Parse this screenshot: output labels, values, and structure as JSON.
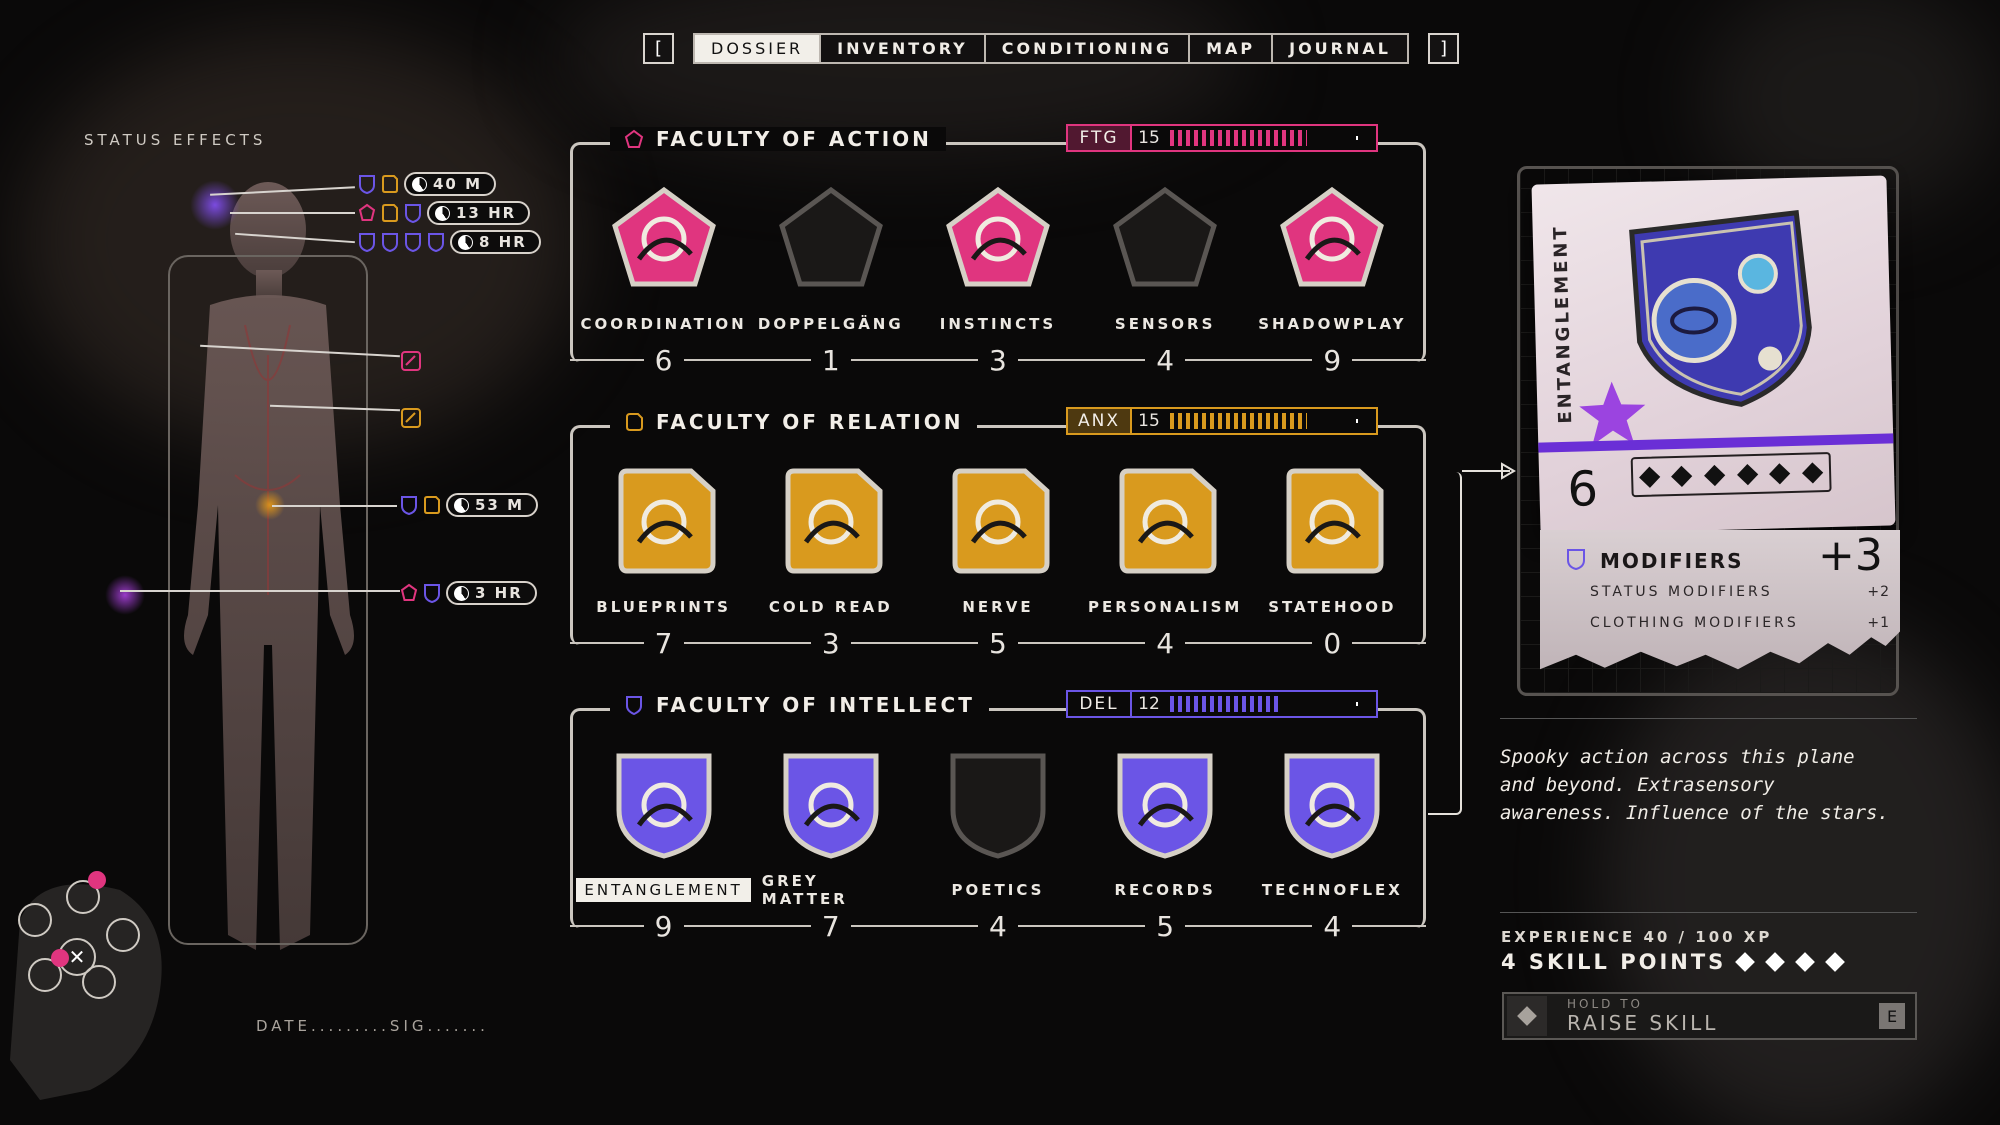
{
  "nav": {
    "left_bracket": "[",
    "right_bracket": "]",
    "tabs": [
      "DOSSIER",
      "INVENTORY",
      "CONDITIONING",
      "MAP",
      "JOURNAL"
    ],
    "active_tab": "DOSSIER"
  },
  "status": {
    "title": "STATUS EFFECTS",
    "effects": [
      {
        "duration": "40 M"
      },
      {
        "duration": "13 HR"
      },
      {
        "duration": "8 HR"
      },
      {
        "duration": "53 M"
      },
      {
        "duration": "3 HR"
      }
    ],
    "date_sig": "DATE.........SIG......."
  },
  "faculties": [
    {
      "title": "FACULTY OF ACTION",
      "meter_code": "FTG",
      "meter_value": "15",
      "meter_fraction": 0.85,
      "color": "#e0357f",
      "skills": [
        {
          "name": "COORDINATION",
          "value": "6"
        },
        {
          "name": "DOPPELGÄNG",
          "value": "1"
        },
        {
          "name": "INSTINCTS",
          "value": "3"
        },
        {
          "name": "SENSORS",
          "value": "4"
        },
        {
          "name": "SHADOWPLAY",
          "value": "9"
        }
      ]
    },
    {
      "title": "FACULTY OF RELATION",
      "meter_code": "ANX",
      "meter_value": "15",
      "meter_fraction": 0.85,
      "color": "#d99a1e",
      "skills": [
        {
          "name": "BLUEPRINTS",
          "value": "7"
        },
        {
          "name": "COLD READ",
          "value": "3"
        },
        {
          "name": "NERVE",
          "value": "5"
        },
        {
          "name": "PERSONALISM",
          "value": "4"
        },
        {
          "name": "STATEHOOD",
          "value": "0"
        }
      ]
    },
    {
      "title": "FACULTY OF INTELLECT",
      "meter_code": "DEL",
      "meter_value": "12",
      "meter_fraction": 0.68,
      "color": "#6b55e6",
      "skills": [
        {
          "name": "ENTANGLEMENT",
          "value": "9"
        },
        {
          "name": "GREY MATTER",
          "value": "7"
        },
        {
          "name": "POETICS",
          "value": "4"
        },
        {
          "name": "RECORDS",
          "value": "5"
        },
        {
          "name": "TECHNOFLEX",
          "value": "4"
        }
      ]
    }
  ],
  "card": {
    "skill": "ENTANGLEMENT",
    "level": "6",
    "modifiers_title": "MODIFIERS",
    "modifiers_total": "+3",
    "modifiers": [
      {
        "label": "STATUS MODIFIERS",
        "value": "+2"
      },
      {
        "label": "CLOTHING MODIFIERS",
        "value": "+1"
      }
    ],
    "description": "Spooky action across this plane and beyond. Extrasensory awareness. Influence of the stars."
  },
  "progress": {
    "experience": "EXPERIENCE 40 / 100 XP",
    "skill_points": "4 SKILL POINTS",
    "hold_to": "HOLD TO",
    "action": "RAISE SKILL",
    "key": "E"
  }
}
